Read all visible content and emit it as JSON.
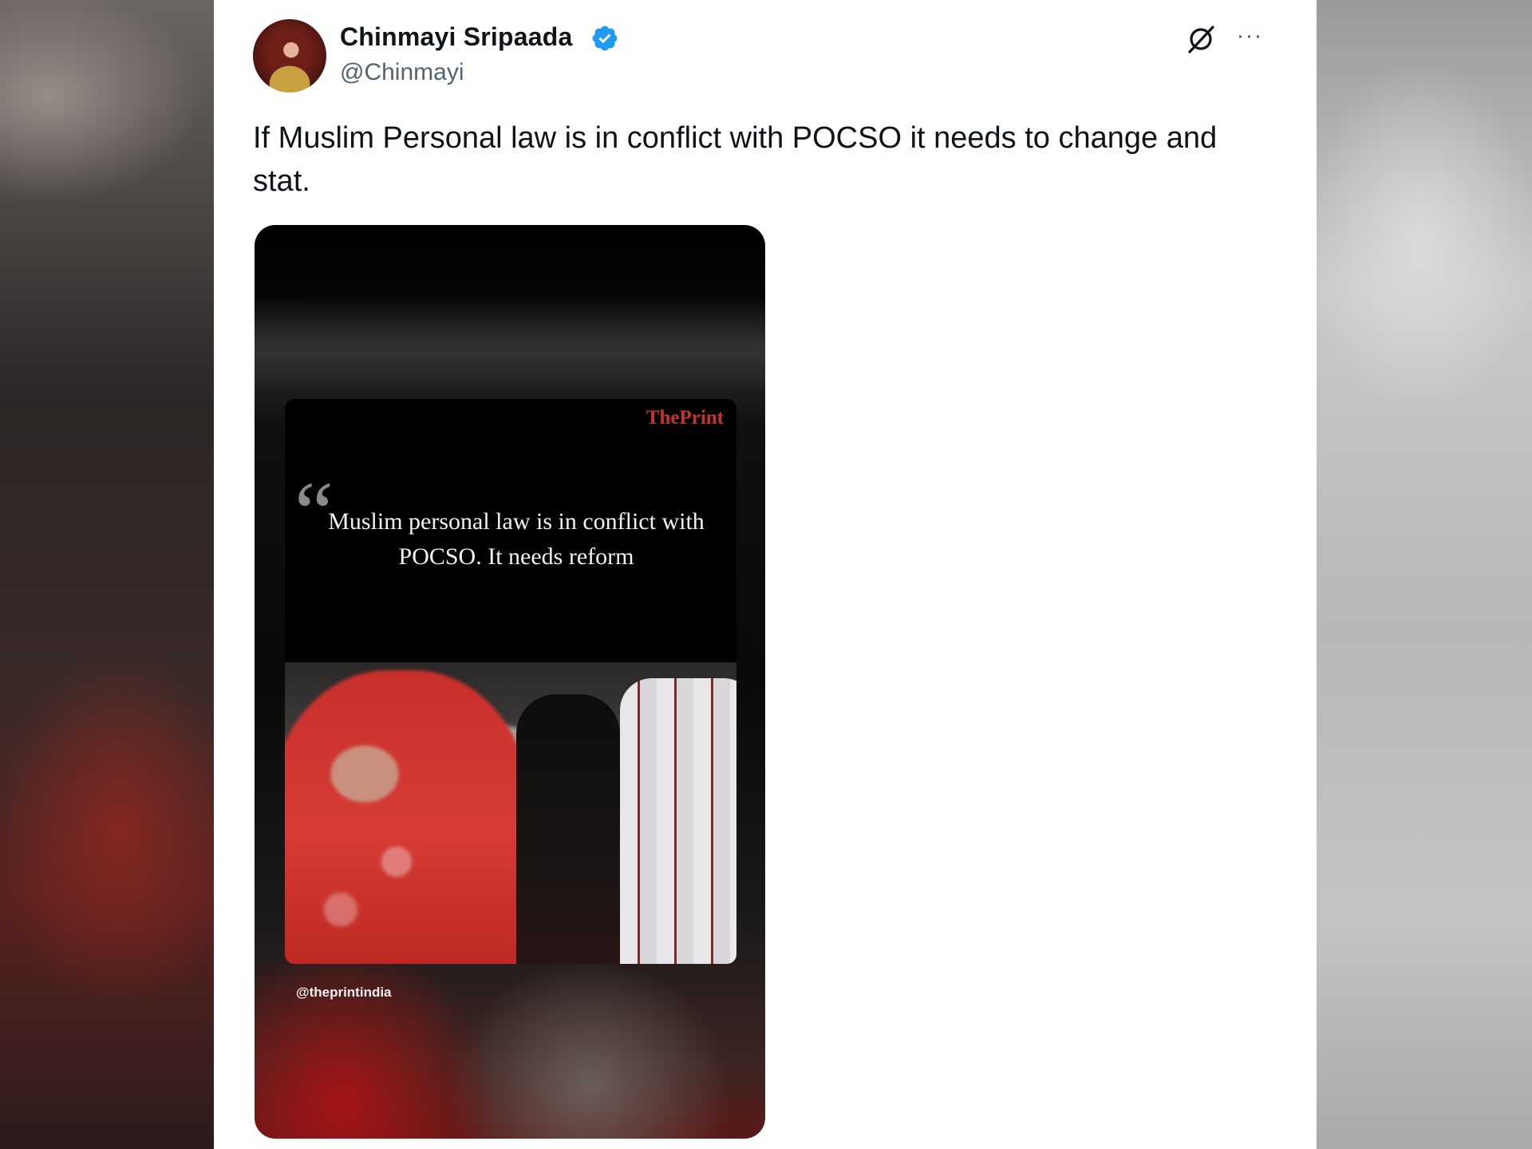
{
  "tweet": {
    "author": {
      "display_name": "Chinmayi Sripaada",
      "handle": "@Chinmayi",
      "verified": true,
      "verified_color": "#1d9bf0"
    },
    "text": "If Muslim Personal law is in conflict with POCSO it needs to change and stat.",
    "actions": {
      "grok_icon": "grok-icon",
      "more_label": "···"
    },
    "media": {
      "brand": "ThePrint",
      "brand_color": "#c8322b",
      "quote_mark": "“",
      "quote": "Muslim personal law is in conflict with POCSO. It needs reform",
      "source_handle": "@theprintindia"
    }
  }
}
